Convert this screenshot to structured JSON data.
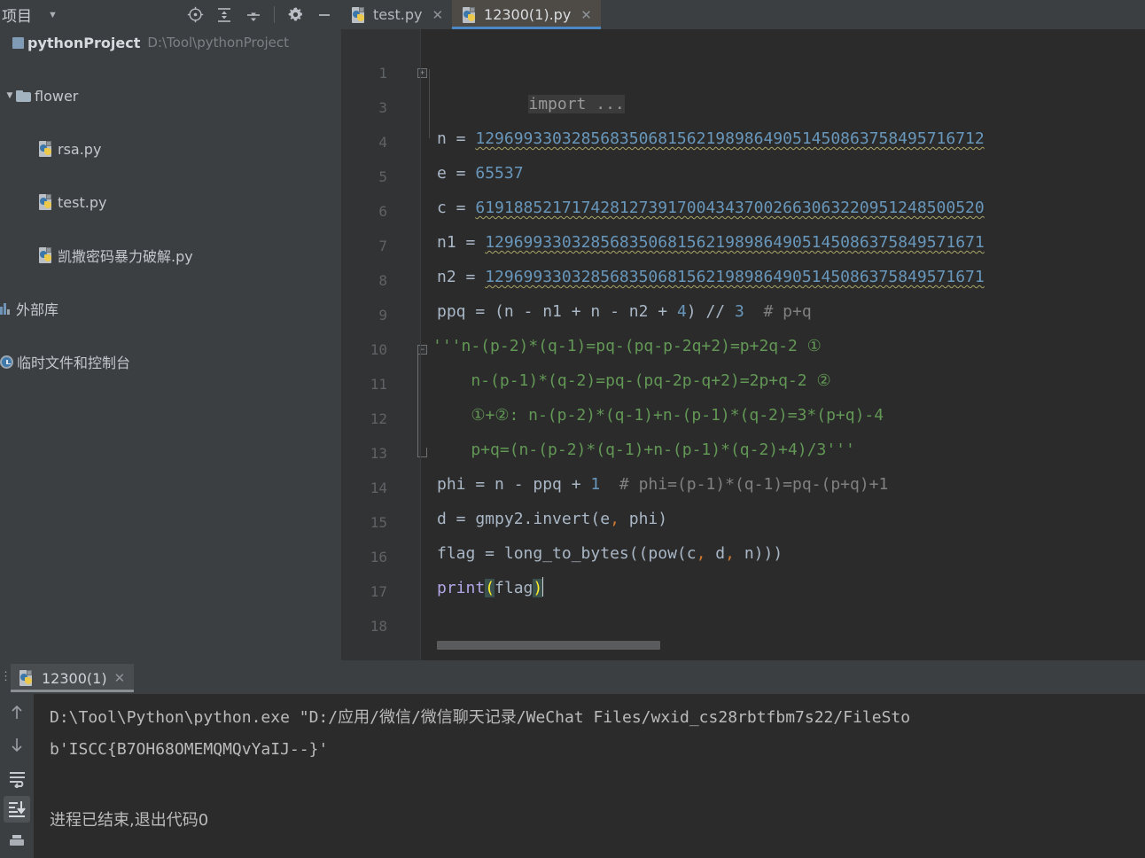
{
  "project_panel": {
    "title": "项目",
    "caret_icon": "chevron-down-icon",
    "toolbar_icons": [
      "scroll-from-source-icon",
      "expand-all-icon",
      "collapse-all-icon",
      "gear-icon",
      "hide-icon"
    ],
    "tree": [
      {
        "label": "pythonProject",
        "path": "D:\\Tool\\pythonProject",
        "icon": "module-icon",
        "arrow": "",
        "depth": 0,
        "kind": "root"
      },
      {
        "label": "flower",
        "path": "",
        "icon": "folder-icon",
        "arrow": "⌄",
        "depth": 1,
        "kind": "folder"
      },
      {
        "label": "rsa.py",
        "path": "",
        "icon": "python-file-icon",
        "arrow": "",
        "depth": 2,
        "kind": "file"
      },
      {
        "label": "test.py",
        "path": "",
        "icon": "python-file-icon",
        "arrow": "",
        "depth": 2,
        "kind": "file"
      },
      {
        "label": "凯撒密码暴力破解.py",
        "path": "",
        "icon": "python-file-icon",
        "arrow": "",
        "depth": 2,
        "kind": "file"
      },
      {
        "label": "外部库",
        "path": "",
        "icon": "external-libraries-icon",
        "arrow": "",
        "depth": 0,
        "kind": "node"
      },
      {
        "label": "临时文件和控制台",
        "path": "",
        "icon": "scratches-consoles-icon",
        "arrow": "",
        "depth": 0,
        "kind": "node"
      }
    ]
  },
  "editor": {
    "tabs": [
      {
        "label": "test.py",
        "icon": "python-file-icon",
        "active": false,
        "close_icon": "close-icon"
      },
      {
        "label": "12300(1).py",
        "icon": "python-file-icon",
        "active": true,
        "close_icon": "close-icon"
      }
    ],
    "line_numbers": [
      "1",
      "3",
      "4",
      "5",
      "6",
      "7",
      "8",
      "9",
      "10",
      "11",
      "12",
      "13",
      "14",
      "15",
      "16",
      "17",
      "18"
    ],
    "fold_markers": {
      "line1": "+",
      "line10": "−",
      "line13": "end"
    },
    "code_lines": [
      {
        "num": "1",
        "type": "folded_import",
        "text": "import ..."
      },
      {
        "num": "3",
        "type": "blank",
        "text": ""
      },
      {
        "num": "4",
        "type": "assign_num_squiggle",
        "name": "n",
        "op": " = ",
        "value": "12969933032856835068156219898649051450863758495716712"
      },
      {
        "num": "5",
        "type": "assign_num",
        "name": "e",
        "op": " = ",
        "value": "65537"
      },
      {
        "num": "6",
        "type": "assign_num_squiggle",
        "name": "c",
        "op": " = ",
        "value": "61918852171742812739170043437002663063220951248500520"
      },
      {
        "num": "7",
        "type": "assign_num_squiggle",
        "name": "n1",
        "op": " = ",
        "value": "1296993303285683506815621989864905145086375849571671"
      },
      {
        "num": "8",
        "type": "assign_num_squiggle",
        "name": "n2",
        "op": " = ",
        "value": "1296993303285683506815621989864905145086375849571671"
      },
      {
        "num": "9",
        "type": "expr_comment",
        "code": "ppq = (n - n1 + n - n2 + 4) // 3",
        "num_tokens": [
          "4",
          "3"
        ],
        "comment": "# p+q"
      },
      {
        "num": "10",
        "type": "doc",
        "text": "'''n-(p-2)*(q-1)=pq-(pq-p-2q+2)=p+2q-2 ①"
      },
      {
        "num": "11",
        "type": "doc",
        "text": "    n-(p-1)*(q-2)=pq-(pq-2p-q+2)=2p+q-2 ②"
      },
      {
        "num": "12",
        "type": "doc",
        "text": "    ①+②: n-(p-2)*(q-1)+n-(p-1)*(q-2)=3*(p+q)-4"
      },
      {
        "num": "13",
        "type": "doc",
        "text": "    p+q=(n-(p-2)*(q-1)+n-(p-1)*(q-2)+4)/3'''"
      },
      {
        "num": "14",
        "type": "expr_comment",
        "code": "phi = n - ppq + 1",
        "comment": "# phi=(p-1)*(q-1)=pq-(p+q)+1"
      },
      {
        "num": "15",
        "type": "call",
        "text": "d = gmpy2.invert(e, phi)"
      },
      {
        "num": "16",
        "type": "call",
        "text": "flag = long_to_bytes((pow(c, d, n)))"
      },
      {
        "num": "17",
        "type": "call_caret",
        "text": "print(flag)"
      },
      {
        "num": "18",
        "type": "blank",
        "text": ""
      }
    ]
  },
  "run_panel": {
    "tab": {
      "label": "12300(1)",
      "icon": "python-file-icon",
      "close_icon": "close-icon"
    },
    "toolbar_icons": [
      "arrow-up-icon",
      "arrow-down-icon",
      "soft-wrap-icon",
      "scroll-to-end-icon",
      "print-icon"
    ],
    "selected_toolbar_icon": "scroll-to-end-icon",
    "console_lines": [
      "D:\\Tool\\Python\\python.exe \"D:/应用/微信/微信聊天记录/WeChat Files/wxid_cs28rbtfbm7s22/FileSto",
      "b'ISCC{B7OH68OMEMQMQvYaIJ--}'",
      "",
      "进程已结束,退出代码0"
    ]
  },
  "colors": {
    "panel_bg": "#3c3f41",
    "editor_bg": "#2b2b2b",
    "gutter_bg": "#313335",
    "active_tab_bg": "#4e4a45",
    "active_tab_underline": "#4a88c7",
    "number_literal": "#6897bb",
    "comment": "#808080",
    "docstring": "#629755",
    "default_text": "#a9b7c6",
    "function_name": "#b3a6e8",
    "keyword_orange": "#cc7832",
    "squiggle": "#a9a567",
    "console_text": "#bbbbbb"
  }
}
